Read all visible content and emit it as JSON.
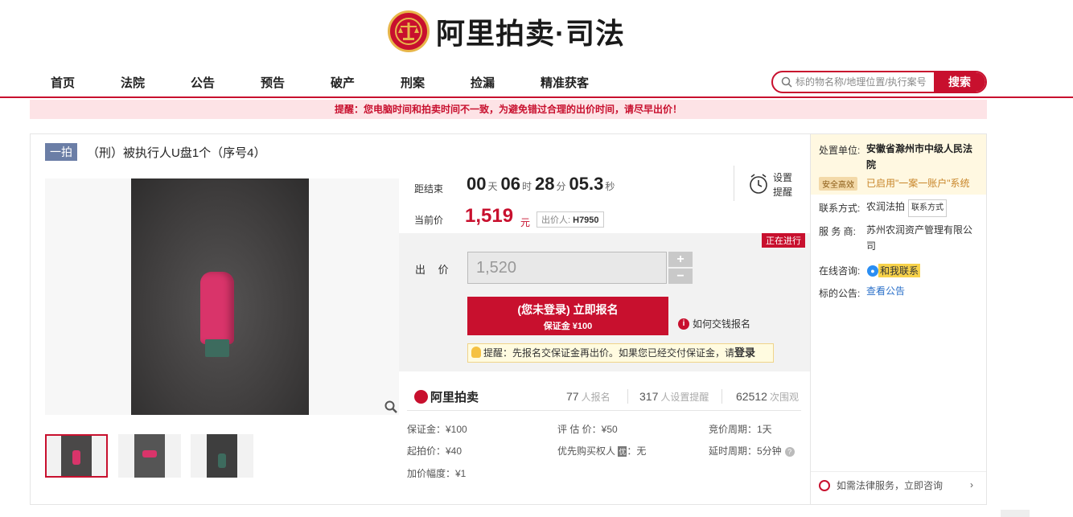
{
  "brand": {
    "name": "阿里拍卖·司法"
  },
  "nav": {
    "items": [
      "首页",
      "法院",
      "公告",
      "预告",
      "破产",
      "刑案",
      "捡漏",
      "精准获客"
    ]
  },
  "search": {
    "placeholder": "标的物名称/地理位置/执行案号",
    "button": "搜索"
  },
  "notice": "提醒：您电脑时间和拍卖时间不一致，为避免错过合理的出价时间，请尽早出价！",
  "item": {
    "badge": "一拍",
    "title": "（刑）被执行人U盘1个（序号4）"
  },
  "countdown": {
    "label": "距结束",
    "days": "00",
    "days_unit": "天",
    "hours": "06",
    "hours_unit": "时",
    "minutes": "28",
    "minutes_unit": "分",
    "seconds": "05.3",
    "seconds_unit": "秒"
  },
  "reminder": {
    "line1": "设置",
    "line2": "提醒"
  },
  "price": {
    "label": "当前价",
    "value": "1,519",
    "unit": "元",
    "bidder_label": "出价人:",
    "bidder": "H7950"
  },
  "status": "正在进行",
  "bid": {
    "label": "出 价",
    "value": "1,520",
    "plus": "+",
    "minus": "−",
    "signup_line1": "(您未登录) 立即报名",
    "signup_line2": "保证金 ¥100",
    "howto": "如何交钱报名",
    "tip": "提醒：先报名交保证金再出价。如果您已经交付保证金，请",
    "tip_link": "登录"
  },
  "stats": {
    "logo": "阿里拍卖",
    "signups": "77",
    "signups_label": "人报名",
    "reminders": "317",
    "reminders_label": "人设置提醒",
    "views": "62512",
    "views_label": "次围观"
  },
  "details": {
    "deposit": "保证金：¥100",
    "appraisal": "评 估 价：¥50",
    "cycle": "竞价周期：1天",
    "start_price": "起拍价：¥40",
    "priority_label": "优先购买权人",
    "priority_mark": "优",
    "priority_value": "：无",
    "delay": "延时周期：5分钟",
    "increment": "加价幅度：¥1"
  },
  "sidebar": {
    "unit_label": "处置单位:",
    "court": "安徽省滁州市中级人民法院",
    "safe_badge": "安全高效",
    "one_account": "已启用\"一案一账户\"系统",
    "contact_label": "联系方式:",
    "contact_name": "农润法拍",
    "contact_btn": "联系方式",
    "service_label": "服 务 商:",
    "service_value": "苏州农润资产管理有限公司",
    "online_label": "在线咨询:",
    "online_value": "和我联系",
    "announce_label": "标的公告:",
    "announce_link": "查看公告",
    "consult": "如需法律服务，立即咨询"
  },
  "colors": {
    "brand_red": "#c8102e",
    "link_blue": "#2b70c9",
    "badge_blue": "#6b7ea6"
  }
}
